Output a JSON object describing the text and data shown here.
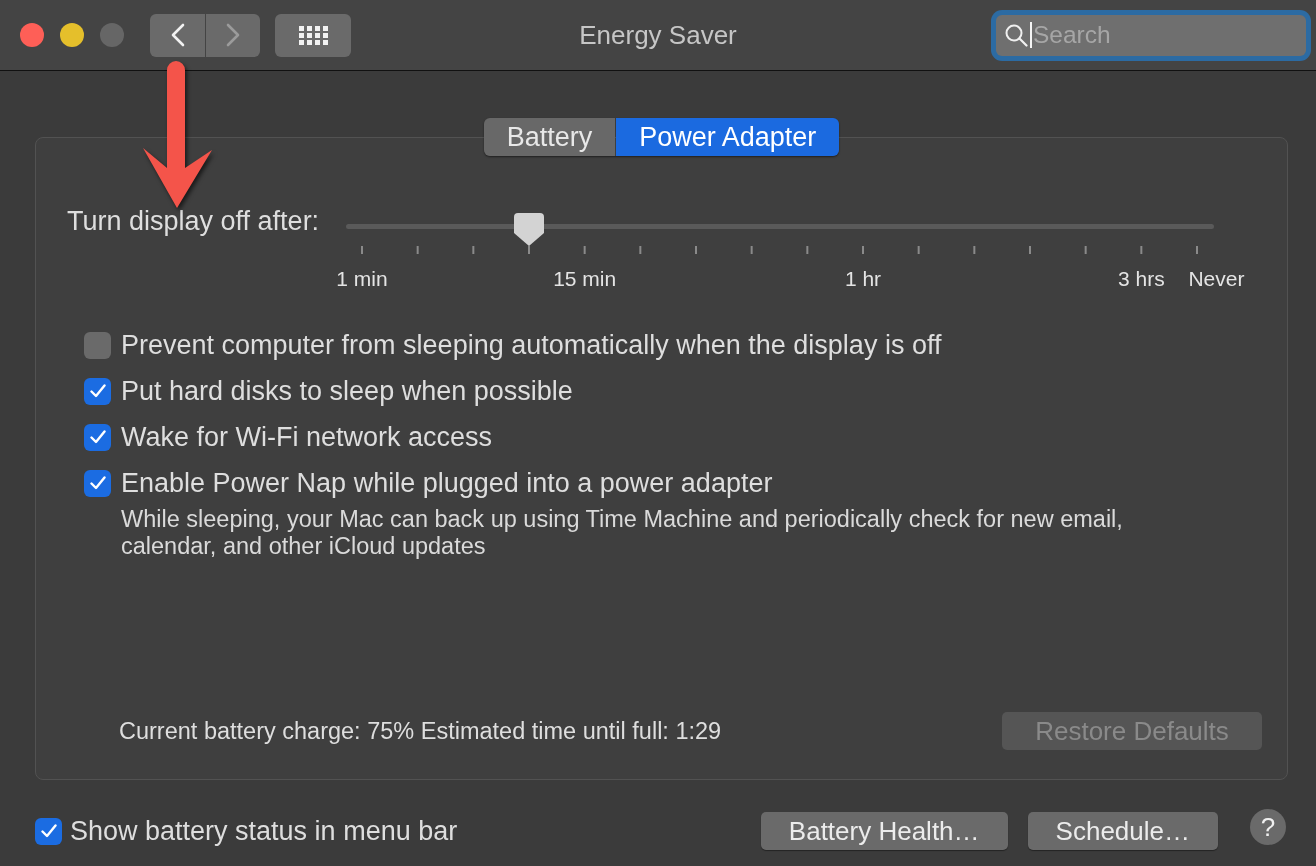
{
  "window": {
    "title": "Energy Saver",
    "controls": [
      {
        "kind": "close",
        "disabled": false
      },
      {
        "kind": "minimize",
        "disabled": false
      },
      {
        "kind": "zoom",
        "disabled": true
      }
    ]
  },
  "toolbar": {
    "back": {
      "disabled": false
    },
    "forward": {
      "disabled": true
    }
  },
  "search": {
    "placeholder": "Search",
    "focused": true
  },
  "tabs": [
    {
      "label": "Battery",
      "selected": false
    },
    {
      "label": "Power Adapter",
      "selected": true
    }
  ],
  "display_sleep": {
    "label": "Turn display off after:",
    "level": 0.2,
    "tick_labels": [
      "1 min",
      "15 min",
      "1 hr",
      "3 hrs",
      "Never"
    ]
  },
  "options": [
    {
      "label": "Prevent computer from sleeping automatically when the display is off",
      "checked": false
    },
    {
      "label": "Put hard disks to sleep when possible",
      "checked": true
    },
    {
      "label": "Wake for Wi-Fi network access",
      "checked": true
    },
    {
      "label": "Enable Power Nap while plugged into a power adapter",
      "checked": true,
      "description": "While sleeping, your Mac can back up using Time Machine and periodically check for new email, calendar, and other iCloud updates"
    }
  ],
  "battery_status": "Current battery charge: 75% Estimated time until full: 1:29",
  "restore_defaults": {
    "label": "Restore Defaults",
    "disabled": true
  },
  "footer": {
    "show_status": {
      "label": "Show battery status in menu bar",
      "checked": true
    },
    "buttons": [
      "Battery Health…",
      "Schedule…"
    ],
    "help": "?"
  }
}
